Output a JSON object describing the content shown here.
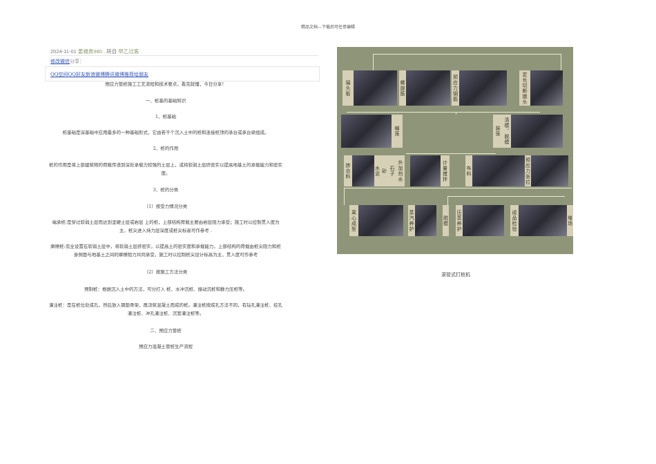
{
  "header": "精品文档---下载后可任意编辑",
  "meta": {
    "date": "2024-11-01",
    "author": "姜福贵980...",
    "action": "转自",
    "source": "甲乙过客"
  },
  "share": {
    "link": "修改微信",
    "text": "分享："
  },
  "share_targets": "QQ空间QQ好友新浪微博腾讯微博推荐给朋友",
  "body": {
    "intro": "预应力管桩施工工艺流程和技术要点，看完就懂，今日分享！",
    "s1": "一、桩基的基础知识",
    "s1_1": "1、桩基础",
    "p1": "桩基础是深基础中应用最多的一种基础形式，它由若干个沉入土中的桩和连接桩顶的承台或承台梁组成。",
    "s1_2": "2、桩的作用",
    "p2": "桩的作用是将上部建筑物的荷载传递到深处承载力较强的土层上，或将软弱土层挤密实以提高地基土的承载能力和密实度。",
    "s1_3": "3、桩的分类",
    "s1_3_1": "（1）按受力情况分类",
    "p3": "端承桩:是穿过软弱土层而达到坚硬土层或岩层 上的桩，上部结构荷载主要由岩层阻力承受；施工时以控制贯入度为主，桩尖进入持力层深度或桩尖标高可作参考 .",
    "p4": "摩擦桩:完全设置在软弱土层中，将软弱土层挤密实，以提高土的密实度和承载能力，上部结构的荷载由桩尖阻力和桩身侧面与地基土之间的摩擦阻力共同承受，施工时以控制桩尖设计标高为主，贯入度可作参考",
    "s1_3_2": "（2）按施工方法分类",
    "p5": "预制桩：根据沉入土中的方法，可分打入 桩、水冲沉桩、振动沉桩和静力压桩等。",
    "p6": "灌注桩：是在桩位处成孔，然后放入钢筋骨架，再浇筑混凝土而成的桩。灌注桩按成孔方法不同，有钻孔灌注桩、挖孔灌注桩、冲孔灌注桩、沉管灌注桩等。",
    "s2": "二、预应力管桩",
    "s2_1": "预应力混凝土管桩生产流程"
  },
  "figure": {
    "labels": [
      "端头板",
      "螺旋筋",
      "预应力钢筋",
      "定长切断镦头",
      "编笼",
      "装笼",
      "清模、脱模",
      "掺合料",
      "水泥",
      "砂",
      "石子",
      "外加剂水",
      "计量搅拌",
      "布料",
      "预应力张拉",
      "离心成型",
      "蒸汽养护",
      "脱模",
      "压蒸养护",
      "成品检验",
      "堆场"
    ],
    "caption": "滚管式打桩机"
  }
}
